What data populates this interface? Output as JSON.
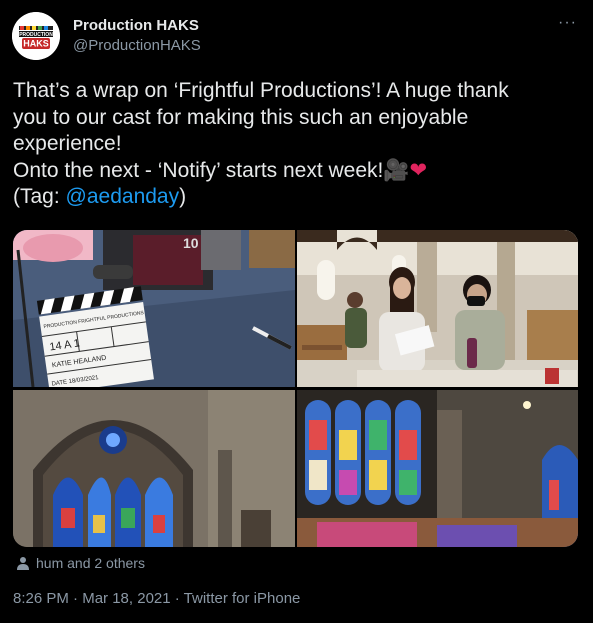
{
  "author": {
    "display_name": "Production HAKS",
    "handle": "@ProductionHAKS",
    "avatar_logo_text": "PRODUCTION HAKS"
  },
  "tweet": {
    "line1": "That’s a wrap on ‘Frightful Productions’! A huge thank",
    "line2": "you to our cast for making this such an enjoyable",
    "line3": "experience!",
    "line4": "Onto the next - ‘Notify’ starts next week!",
    "line4_emoji_camera": "🎥",
    "line4_emoji_heart": "❤",
    "line5_prefix": "(Tag: ",
    "mention": "@aedanday",
    "line5_suffix": ")"
  },
  "media": {
    "clapper_lines": [
      "PRODUCTION FRIGHTFUL PRODUCTIONS",
      "14  A  1",
      "KATIE HEALAND",
      "DATE 18/03/2021"
    ]
  },
  "likes": {
    "text": "hum and 2 others"
  },
  "meta": {
    "time": "8:26 PM",
    "sep1": " · ",
    "date": "Mar 18, 2021",
    "sep2": " · ",
    "source": "Twitter for iPhone"
  },
  "colors": {
    "background": "#000000",
    "text": "#e7e9ea",
    "secondary": "#8b98a5",
    "link": "#1d9bf0",
    "heart": "#e0245e"
  },
  "icons": [
    "more-icon",
    "person-icon",
    "camera-emoji",
    "heart-emoji"
  ]
}
